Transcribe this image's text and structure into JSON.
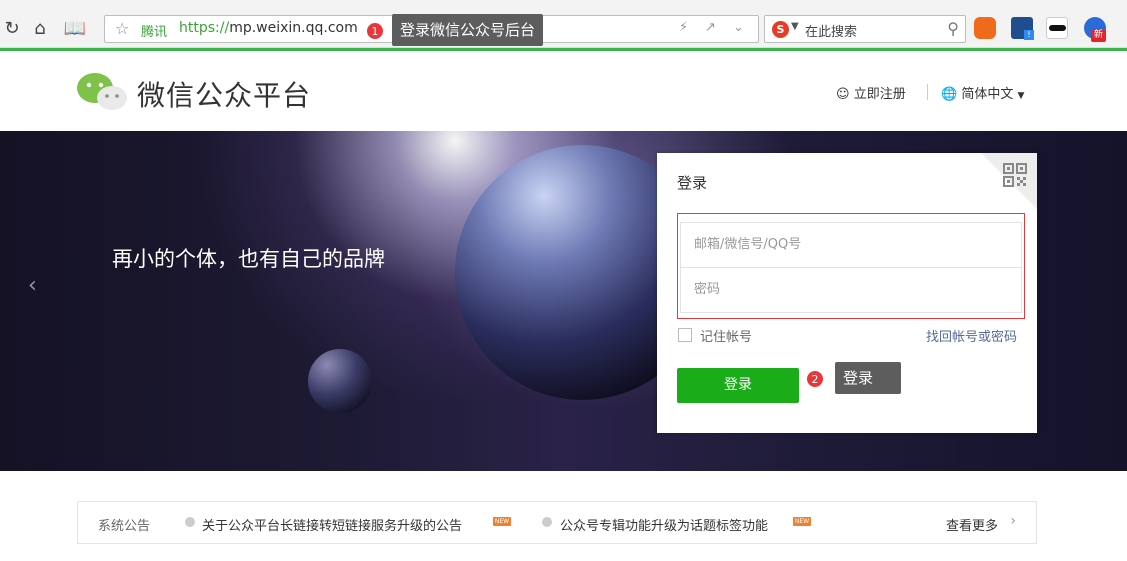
{
  "browser": {
    "brand_label": "腾讯",
    "url_scheme": "https://",
    "url_host": "mp.weixin.qq.com",
    "search_placeholder": "在此搜索",
    "search_engine_letter": "S",
    "ext_badge_new": "新"
  },
  "callouts": [
    {
      "number": "1",
      "text": "登录微信公众号后台"
    },
    {
      "number": "2",
      "text": "登录"
    }
  ],
  "header": {
    "title": "微信公众平台",
    "register_label": "立即注册",
    "language_label": "简体中文"
  },
  "banner": {
    "slogan": "再小的个体，也有自己的品牌"
  },
  "login": {
    "title": "登录",
    "username_placeholder": "邮箱/微信号/QQ号",
    "password_placeholder": "密码",
    "remember_label": "记住帐号",
    "find_account_link": "找回帐号或密码",
    "submit_label": "登录"
  },
  "notices": {
    "label": "系统公告",
    "items": [
      {
        "text": "关于公众平台长链接转短链接服务升级的公告",
        "badge": "NEW"
      },
      {
        "text": "公众号专辑功能升级为话题标签功能",
        "badge": "NEW"
      }
    ],
    "more_label": "查看更多"
  },
  "colors": {
    "accent_green": "#1aad19",
    "browser_green": "#3bb54a",
    "error_border": "#e03a3a",
    "link_blue": "#576b95"
  }
}
